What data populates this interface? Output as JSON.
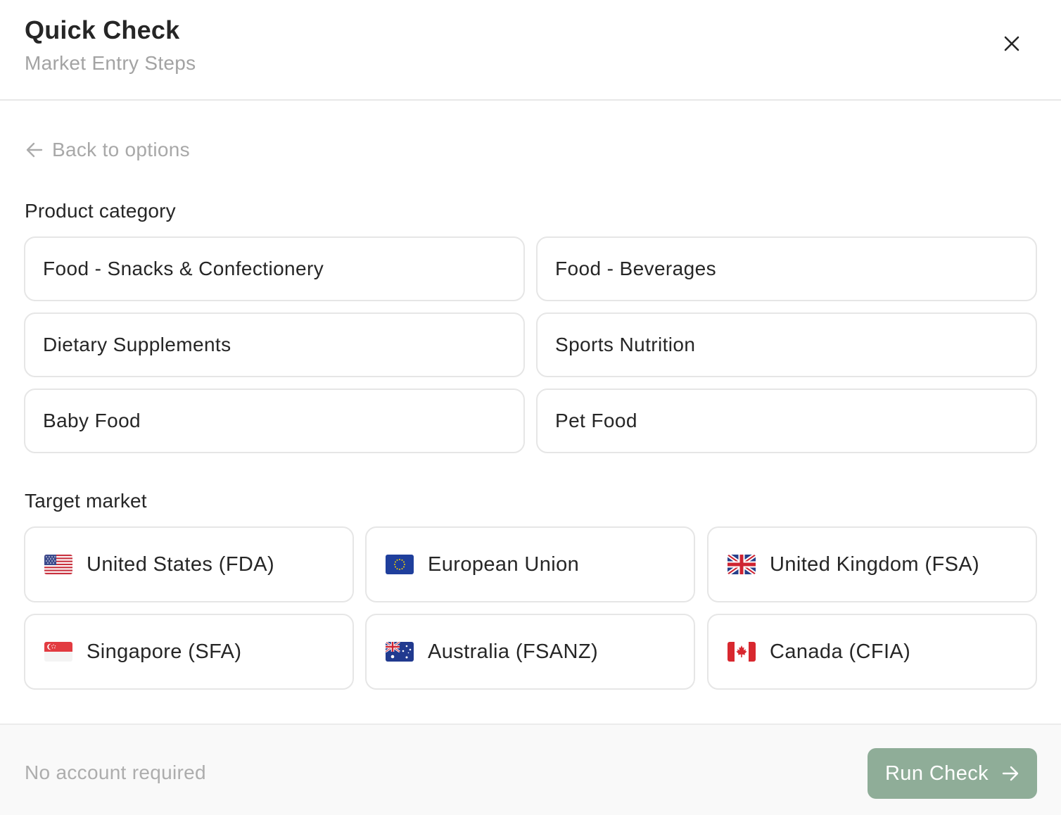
{
  "header": {
    "title": "Quick Check",
    "subtitle": "Market Entry Steps",
    "close_icon": "close-icon"
  },
  "back_link": {
    "label": "Back to options",
    "icon": "arrow-left-icon"
  },
  "product_category": {
    "label": "Product category",
    "options": [
      "Food - Snacks & Confectionery",
      "Food - Beverages",
      "Dietary Supplements",
      "Sports Nutrition",
      "Baby Food",
      "Pet Food"
    ]
  },
  "target_market": {
    "label": "Target market",
    "options": [
      {
        "label": "United States (FDA)",
        "flag": "us-flag-icon"
      },
      {
        "label": "European Union",
        "flag": "eu-flag-icon"
      },
      {
        "label": "United Kingdom (FSA)",
        "flag": "uk-flag-icon"
      },
      {
        "label": "Singapore (SFA)",
        "flag": "sg-flag-icon"
      },
      {
        "label": "Australia (FSANZ)",
        "flag": "au-flag-icon"
      },
      {
        "label": "Canada (CFIA)",
        "flag": "ca-flag-icon"
      }
    ]
  },
  "footer": {
    "note": "No account required",
    "run_button_label": "Run Check",
    "run_button_icon": "arrow-right-icon"
  },
  "colors": {
    "accent": "#8fad98",
    "border": "#e6e6e6",
    "muted_text": "#a8a8a8",
    "footer_bg": "#f9f9f9"
  }
}
